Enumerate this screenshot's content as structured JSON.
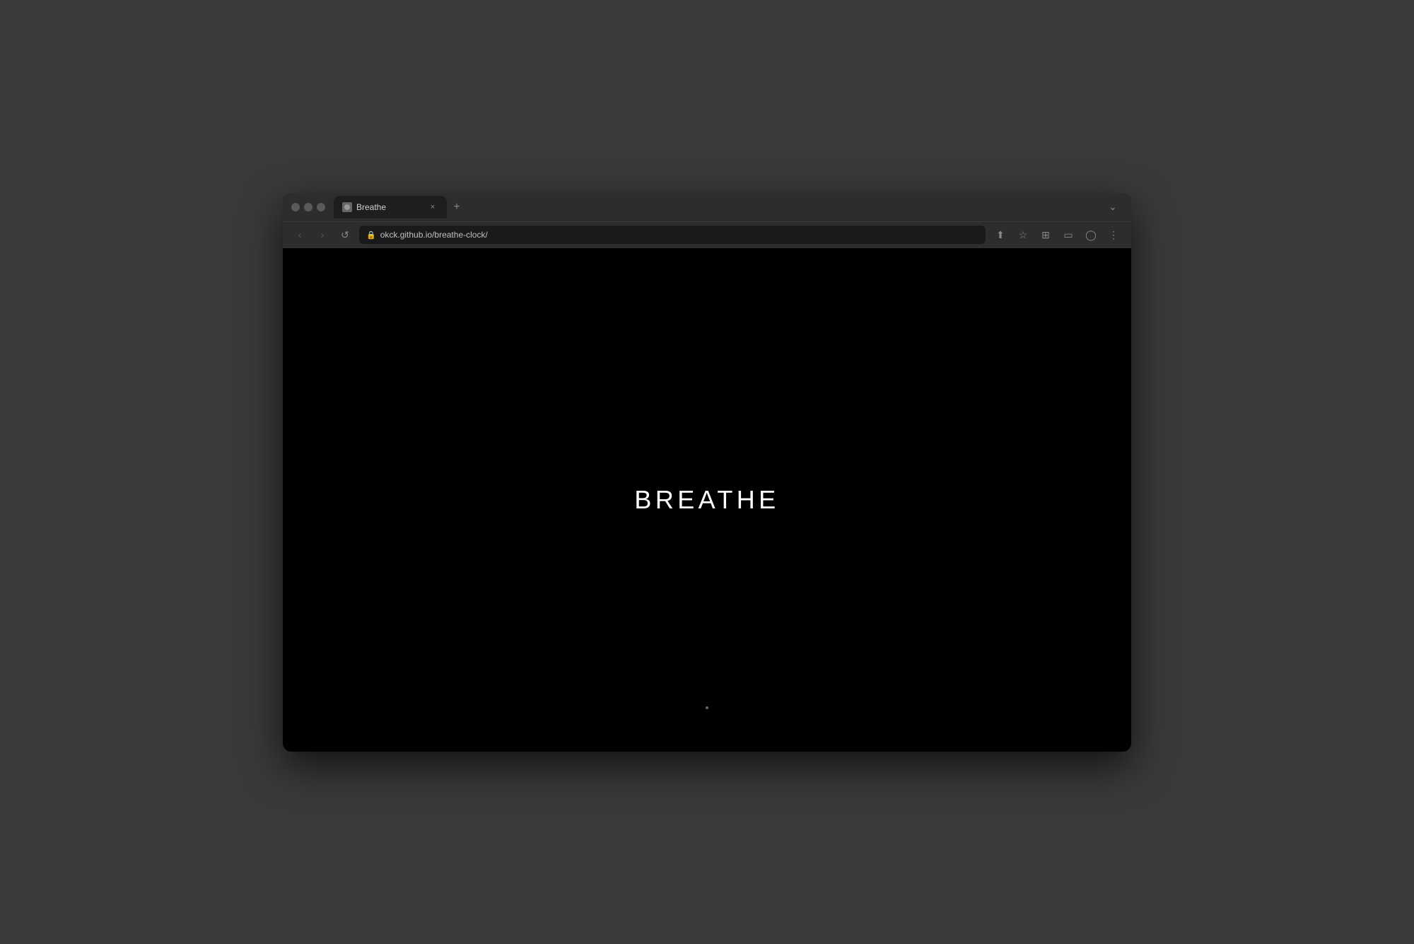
{
  "browser": {
    "window_title": "Breathe",
    "tab": {
      "label": "Breathe",
      "close_label": "×"
    },
    "new_tab_label": "+",
    "dropdown_label": "⌄",
    "nav": {
      "back_label": "‹",
      "forward_label": "›",
      "reload_label": "↺"
    },
    "address_bar": {
      "url": "okck.github.io/breathe-clock/",
      "lock_icon": "🔒"
    },
    "toolbar": {
      "share_icon": "⬆",
      "bookmark_icon": "☆",
      "bookmarks_icon": "⊞",
      "sidebar_icon": "▭",
      "profile_icon": "◯",
      "menu_icon": "⋮"
    }
  },
  "page": {
    "main_text": "BREATHE",
    "background_color": "#000000",
    "text_color": "#ffffff"
  }
}
